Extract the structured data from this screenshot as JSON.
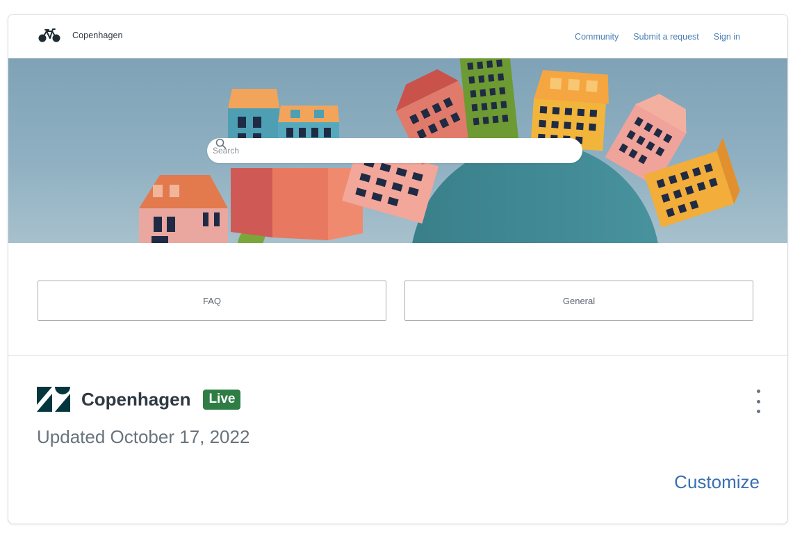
{
  "preview": {
    "brand_name": "Copenhagen",
    "nav": [
      "Community",
      "Submit a request",
      "Sign in"
    ],
    "search": {
      "placeholder": "Search"
    },
    "blocks": [
      "FAQ",
      "General"
    ]
  },
  "theme": {
    "name": "Copenhagen",
    "status": "Live",
    "updated": "Updated October 17, 2022",
    "customize_label": "Customize"
  },
  "colors": {
    "live_badge": "#2e7d45",
    "link": "#3a6fb0",
    "nav_link": "#4a7fb5"
  },
  "icons": {
    "brand": "bicycle-icon",
    "search": "search-icon",
    "theme_logo": "zendesk-logo-icon",
    "more": "more-vertical-icon"
  }
}
